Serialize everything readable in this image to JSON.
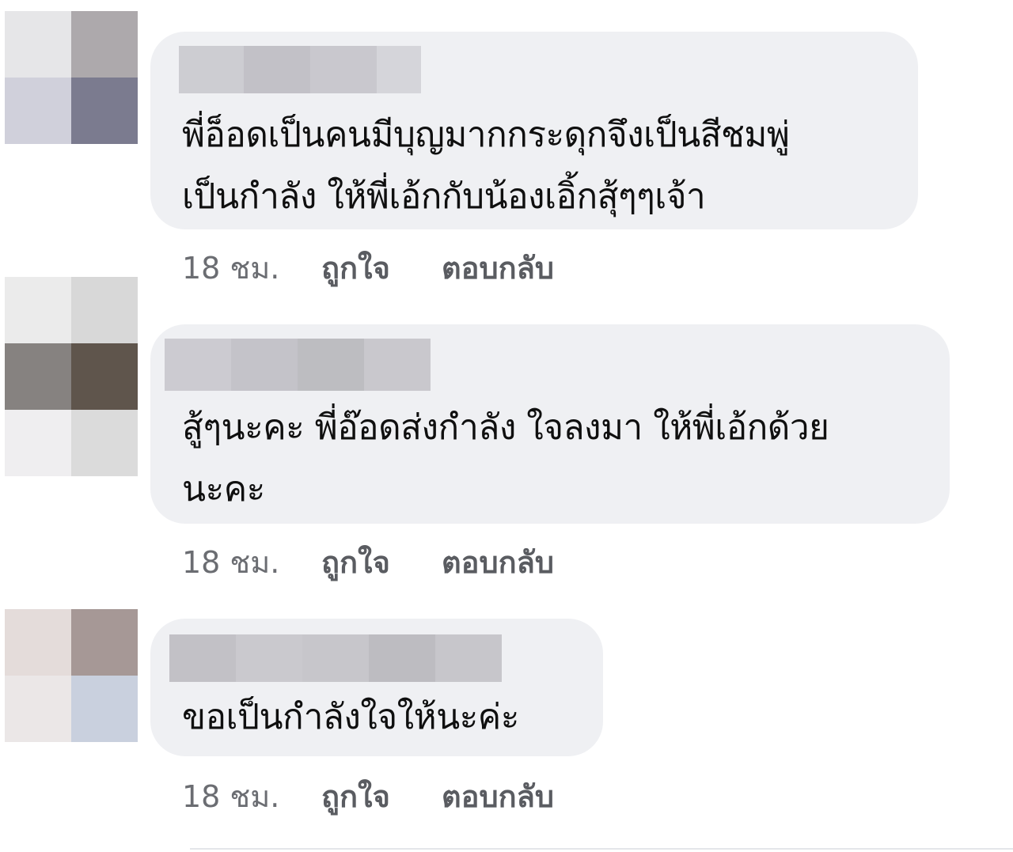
{
  "comments": [
    {
      "text": "พี่อ็อดเป็นคนมีบุญมากกระดุกจึงเป็นสีชมพู่\nเป็นกำลัง ให้พี่เอ้กกับน้องเอิ้กสุ้ๆๆเจ้า",
      "time": "18 ชม.",
      "like": "ถูกใจ",
      "reply": "ตอบกลับ",
      "avatar_colors": [
        "#e6e6e8",
        "#ada9ac",
        "#d0d0db",
        "#7b7b8f"
      ],
      "name_blur_colors": [
        "#cdcdd2",
        "#c2c1c7",
        "#c9c8ce",
        "#d5d5da"
      ]
    },
    {
      "text": "สู้ๆนะคะ พี่อ๊อดส่งกำลัง ใจลงมา ให้พี่เอ้กด้วย\nนะคะ",
      "time": "18 ชม.",
      "like": "ถูกใจ",
      "reply": "ตอบกลับ",
      "avatar_colors": [
        "#ebebeb",
        "#d8d8d8",
        "#868280",
        "#5f554c",
        "#efeef0",
        "#dbdbdb",
        "#f3f3f3",
        "#f3f3f3"
      ],
      "name_blur_colors": [
        "#cccbd1",
        "#c4c3c9",
        "#bdbdc1",
        "#c9c8cd"
      ]
    },
    {
      "text": "ขอเป็นกำลังใจให้นะค่ะ",
      "time": "18 ชม.",
      "like": "ถูกใจ",
      "reply": "ตอบกลับ",
      "avatar_colors": [
        "#e4dcda",
        "#a69896",
        "#ebe7e7",
        "#c9d0de"
      ],
      "name_blur_colors": [
        "#c2c1c6",
        "#cac9ce",
        "#c7c6cb",
        "#bdbcc1",
        "#c7c6cb"
      ]
    }
  ]
}
